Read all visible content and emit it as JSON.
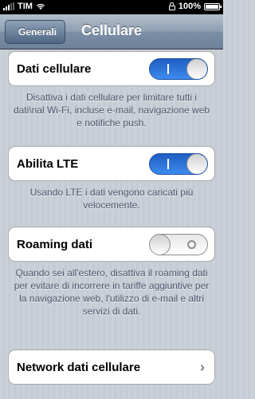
{
  "status": {
    "carrier": "TIM",
    "battery": "100%"
  },
  "navbar": {
    "back_label": "Generali",
    "title": "Cellulare"
  },
  "sections": {
    "cellular_data": {
      "label": "Dati cellulare",
      "on": true,
      "footer": "Disattiva i dati cellulare per limitare tutti i dati\\nal Wi-Fi, incluse e-mail, navigazione web e notifiche push."
    },
    "lte": {
      "label": "Abilita LTE",
      "on": true,
      "footer": "Usando LTE i dati vengono caricati più velocemente."
    },
    "roaming": {
      "label": "Roaming dati",
      "on": false,
      "footer": "Quando sei all'estero, disattiva il roaming dati per evitare di incorrere in tariffe aggiuntive per la navigazione web, l'utilizzo di e-mail e altri servizi di dati."
    },
    "network": {
      "label": "Network dati cellulare"
    }
  },
  "colors": {
    "switch_on": "#3d8aef",
    "background": "#c5ccd4",
    "footer_text": "#4c566c"
  },
  "icons": {
    "wifi": "wifi-icon",
    "lock": "lock-icon",
    "battery": "battery-icon",
    "chevron": "chevron-right-icon"
  }
}
